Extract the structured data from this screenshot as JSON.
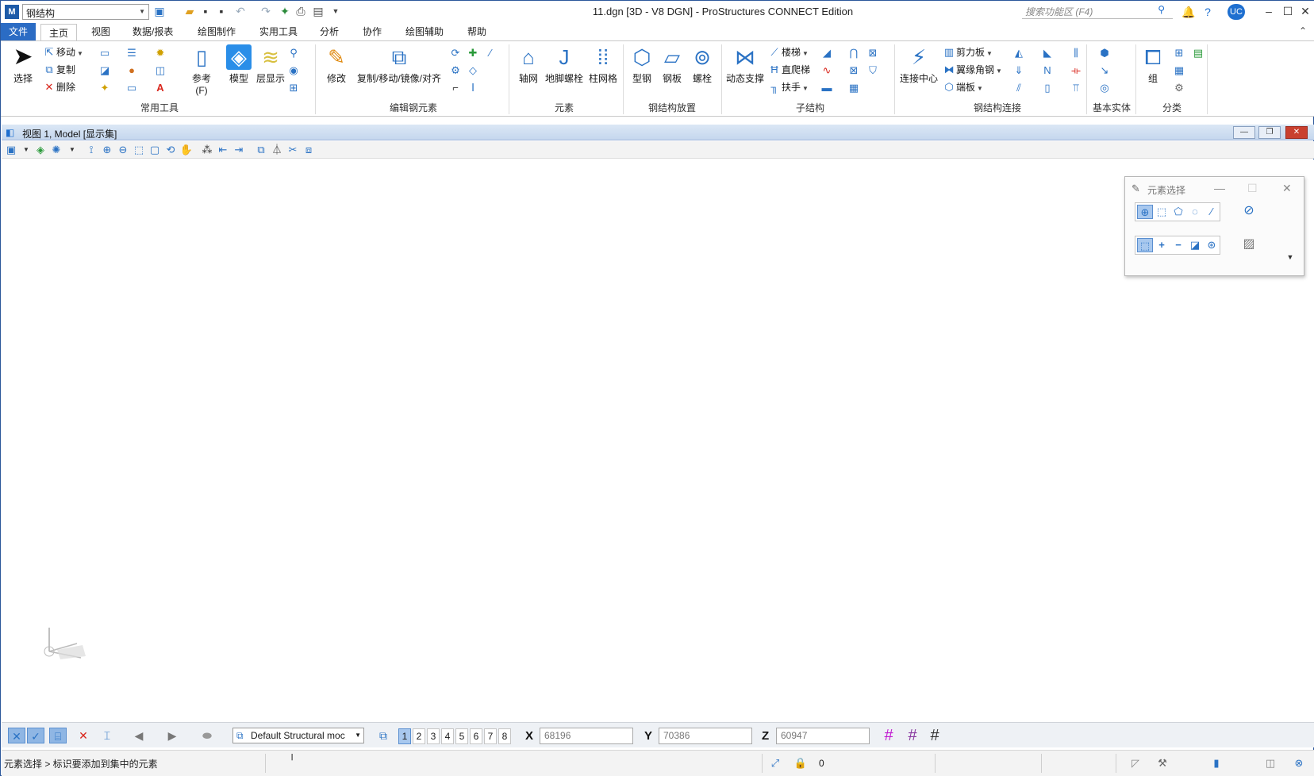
{
  "titlebar": {
    "workflow": "钢结构",
    "window_title": "11.dgn [3D - V8 DGN] - ProStructures CONNECT Edition",
    "search_placeholder": "搜索功能区 (F4)",
    "user_badge": "UC"
  },
  "tabs": [
    "文件",
    "主页",
    "视图",
    "数据/报表",
    "绘图制作",
    "实用工具",
    "分析",
    "协作",
    "绘图辅助",
    "帮助"
  ],
  "ribbon": {
    "common_tools": {
      "label": "常用工具",
      "select": "选择",
      "move": "移动",
      "copy": "复制",
      "delete": "删除",
      "reference": "参考(F)",
      "model": "模型",
      "level_display": "层显示"
    },
    "edit_steel": {
      "label": "编辑钢元素",
      "modify": "修改",
      "copy_move_mirror_align": "复制/移动/镜像/对齐"
    },
    "elements": {
      "label": "元素",
      "grid": "轴网",
      "anchor_bolt": "地脚螺栓",
      "column_grid": "柱网格"
    },
    "steel_placement": {
      "label": "钢结构放置",
      "shape": "型钢",
      "plate": "钢板",
      "bolt": "螺栓"
    },
    "substructure": {
      "label": "子结构",
      "dynamic_brace": "动态支撑",
      "stair": "楼梯",
      "ladder": "直爬梯",
      "handrail": "扶手"
    },
    "steel_connection": {
      "label": "钢结构连接",
      "connection_center": "连接中心",
      "shear_plate": "剪力板",
      "flange_angle": "翼缘角钢",
      "end_plate": "端板"
    },
    "solids": {
      "label": "基本实体"
    },
    "classification": {
      "label": "分类",
      "group": "组"
    }
  },
  "view": {
    "title": "视图 1, Model [显示集]"
  },
  "element_selection": {
    "title": "元素选择"
  },
  "statusbar": {
    "model_name": "Default Structural moc",
    "view_numbers": [
      "1",
      "2",
      "3",
      "4",
      "5",
      "6",
      "7",
      "8"
    ],
    "x_label": "X",
    "x_value": "68196",
    "y_label": "Y",
    "y_value": "70386",
    "z_label": "Z",
    "z_value": "60947",
    "prompt": "元素选择 > 标识要添加到集中的元素",
    "active_level": "0"
  },
  "colors": {
    "accent": "#2b6cc4",
    "icon_blue": "#2a72c4",
    "delete_red": "#d9261c",
    "grid_magenta": "#c21bd1"
  }
}
